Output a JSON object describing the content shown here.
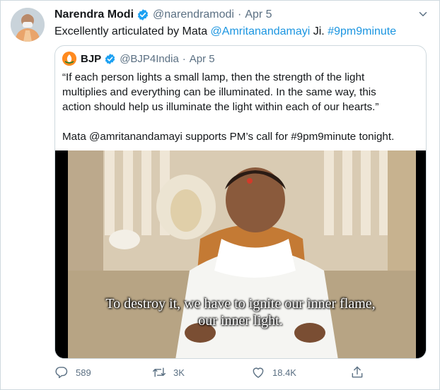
{
  "tweet": {
    "author_name": "Narendra Modi",
    "handle": "@narendramodi",
    "separator": "·",
    "timestamp": "Apr 5",
    "text_prefix": "Excellently articulated by Mata ",
    "mention": "@Amritanandamayi",
    "text_middle": " Ji. ",
    "hashtag": "#9pm9minute"
  },
  "quoted_tweet": {
    "author_name": "BJP",
    "handle": "@BJP4India",
    "separator": "·",
    "timestamp": "Apr 5",
    "lines": [
      "“If each person lights a small lamp, then the strength of the light",
      "multiplies and everything can be illuminated. In the same way, this",
      "action should help us illuminate the light within each of our hearts.”",
      "",
      "Mata @amritanandamayi supports PM’s call for #9pm9minute tonight."
    ],
    "media": {
      "subtitle_line1": "To destroy it, we have to ignite our inner flame,",
      "subtitle_line2": "our inner light."
    }
  },
  "actions": {
    "replies": "589",
    "retweets": "3K",
    "likes": "18.4K"
  },
  "colors": {
    "link": "#1b95e0",
    "verified": "#1da1f2",
    "secondary_text": "#5b7083",
    "border": "#cfd9de"
  },
  "icons": {
    "verified": "verified-badge-icon",
    "menu": "chevron-down-icon",
    "reply": "reply-icon",
    "retweet": "retweet-icon",
    "like": "heart-icon",
    "share": "share-icon"
  }
}
